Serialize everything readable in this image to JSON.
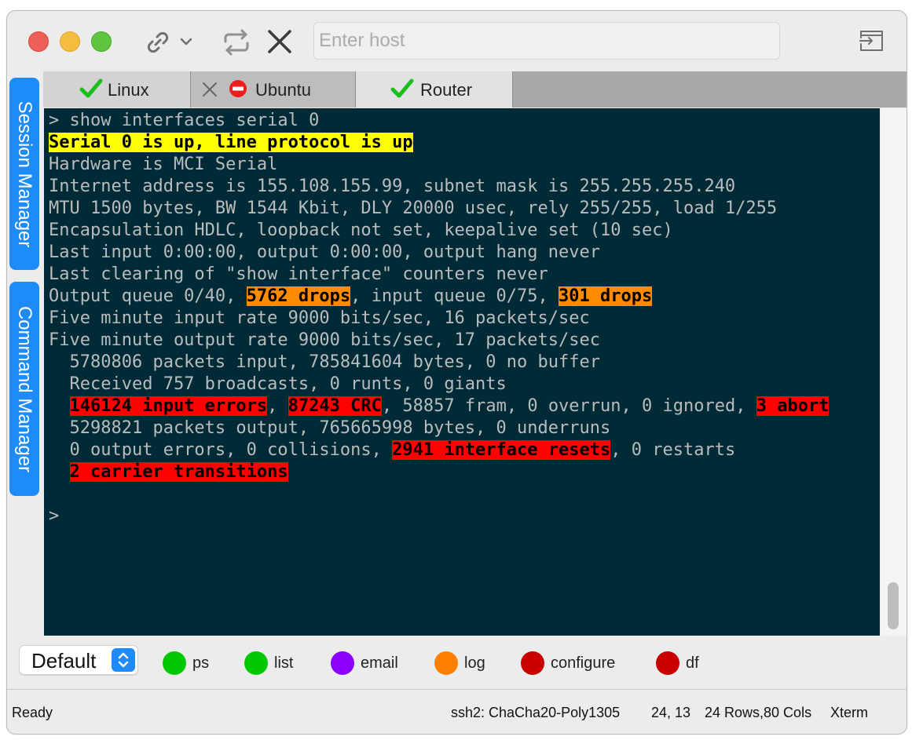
{
  "toolbar": {
    "host_placeholder": "Enter host",
    "icons": [
      "link-icon",
      "chevron-down-icon",
      "reconnect-icon",
      "close-icon",
      "exit-session-icon"
    ]
  },
  "side_panel": {
    "session_manager": "Session Manager",
    "command_manager": "Command Manager"
  },
  "tabs": [
    {
      "label": "Linux",
      "status": "connected"
    },
    {
      "label": "Ubuntu",
      "status": "disconnected"
    },
    {
      "label": "Router",
      "status": "connected"
    }
  ],
  "terminal": {
    "lines": [
      [
        {
          "t": "> show interfaces serial 0"
        }
      ],
      [
        {
          "t": "Serial 0 is up, line protocol is up",
          "hl": "y"
        }
      ],
      [
        {
          "t": "Hardware is MCI Serial"
        }
      ],
      [
        {
          "t": "Internet address is 155.108.155.99, subnet mask is 255.255.255.240"
        }
      ],
      [
        {
          "t": "MTU 1500 bytes, BW 1544 Kbit, DLY 20000 usec, rely 255/255, load 1/255"
        }
      ],
      [
        {
          "t": "Encapsulation HDLC, loopback not set, keepalive set (10 sec)"
        }
      ],
      [
        {
          "t": "Last input 0:00:00, output 0:00:00, output hang never"
        }
      ],
      [
        {
          "t": "Last clearing of \"show interface\" counters never"
        }
      ],
      [
        {
          "t": "Output queue 0/40, "
        },
        {
          "t": "5762 drops",
          "hl": "o"
        },
        {
          "t": ", input queue 0/75, "
        },
        {
          "t": "301 drops",
          "hl": "o"
        }
      ],
      [
        {
          "t": "Five minute input rate 9000 bits/sec, 16 packets/sec"
        }
      ],
      [
        {
          "t": "Five minute output rate 9000 bits/sec, 17 packets/sec"
        }
      ],
      [
        {
          "t": "  5780806 packets input, 785841604 bytes, 0 no buffer"
        }
      ],
      [
        {
          "t": "  Received 757 broadcasts, 0 runts, 0 giants"
        }
      ],
      [
        {
          "t": "  "
        },
        {
          "t": "146124 input errors",
          "hl": "r"
        },
        {
          "t": ", "
        },
        {
          "t": "87243 CRC",
          "hl": "r"
        },
        {
          "t": ", 58857 fram, 0 overrun, 0 ignored, "
        },
        {
          "t": "3 abort",
          "hl": "r"
        }
      ],
      [
        {
          "t": "  5298821 packets output, 765665998 bytes, 0 underruns"
        }
      ],
      [
        {
          "t": "  0 output errors, 0 collisions, "
        },
        {
          "t": "2941 interface resets",
          "hl": "r"
        },
        {
          "t": ", 0 restarts"
        }
      ],
      [
        {
          "t": "  "
        },
        {
          "t": "2 carrier transitions",
          "hl": "r"
        }
      ],
      [
        {
          "t": ""
        }
      ],
      [
        {
          "t": ">"
        }
      ]
    ]
  },
  "quick_commands": {
    "group": "Default",
    "buttons": [
      {
        "label": "ps",
        "color": "#00c800"
      },
      {
        "label": "list",
        "color": "#00c800"
      },
      {
        "label": "email",
        "color": "#8c00ff"
      },
      {
        "label": "log",
        "color": "#ff8000"
      },
      {
        "label": "configure",
        "color": "#c80000"
      },
      {
        "label": "df",
        "color": "#c80000"
      }
    ]
  },
  "status": {
    "state": "Ready",
    "cipher": "ssh2: ChaCha20-Poly1305",
    "cursor": "24, 13",
    "size": "24 Rows,80 Cols",
    "terminal_type": "Xterm"
  }
}
